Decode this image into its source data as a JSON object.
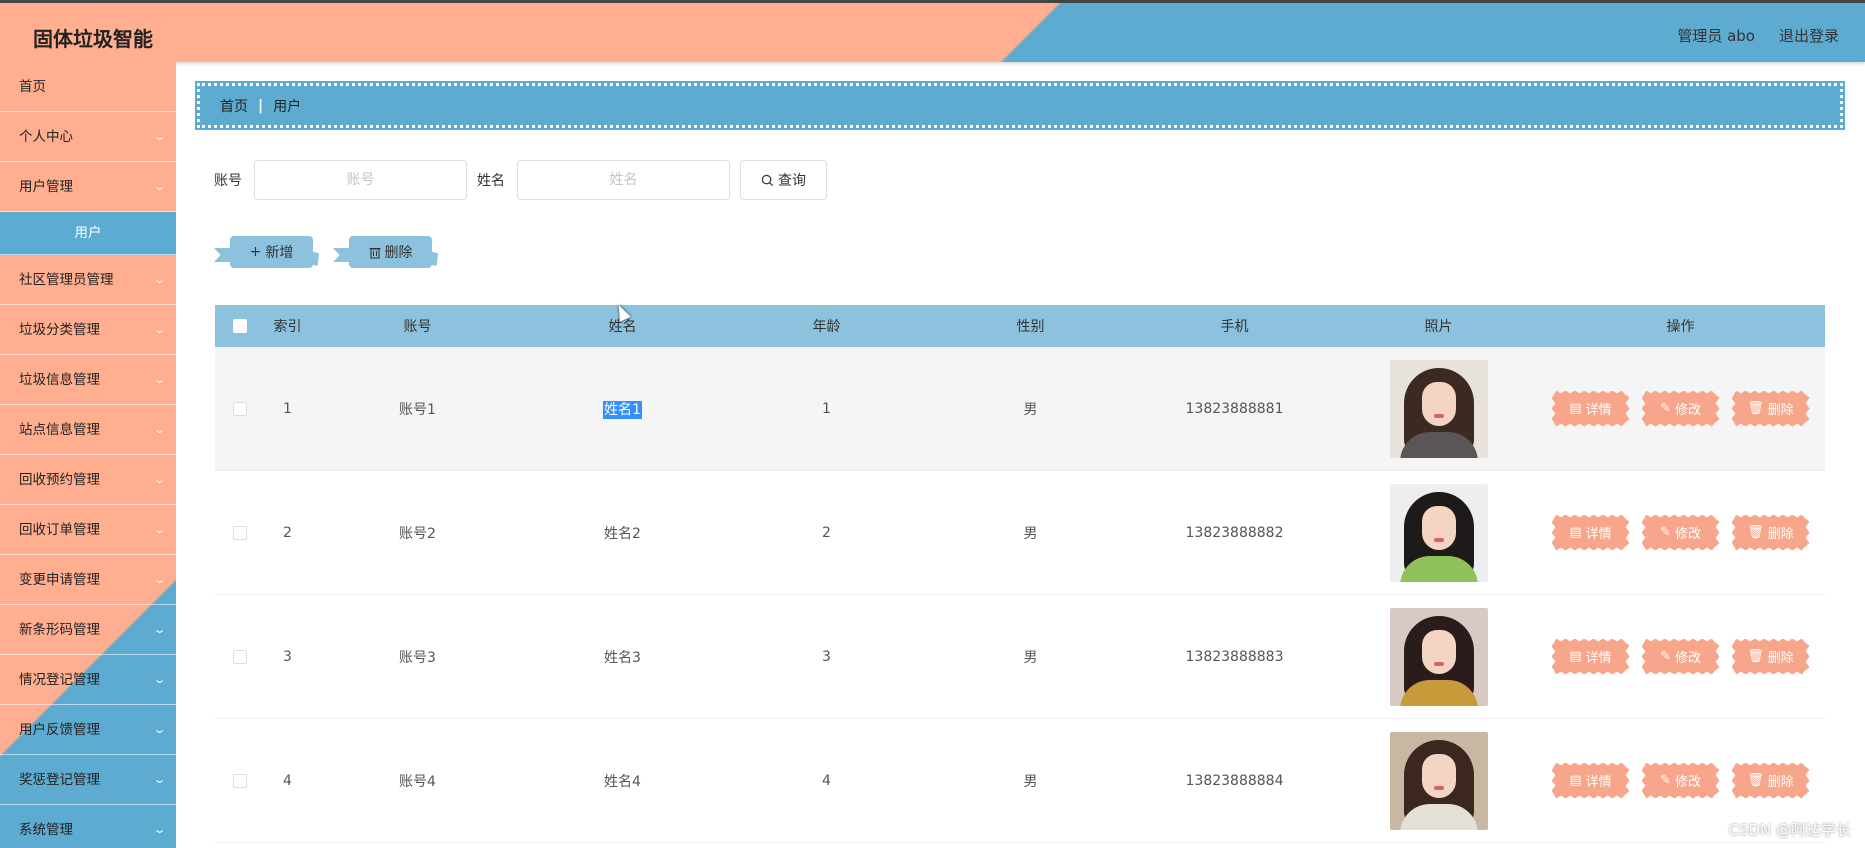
{
  "header": {
    "app_title": "固体垃圾智能",
    "admin_label": "管理员 abo",
    "logout_label": "退出登录"
  },
  "sidebar": {
    "items": [
      {
        "label": "首页",
        "has_chevron": false
      },
      {
        "label": "个人中心",
        "has_chevron": true
      },
      {
        "label": "用户管理",
        "has_chevron": true
      },
      {
        "label": "社区管理员管理",
        "has_chevron": true
      },
      {
        "label": "垃圾分类管理",
        "has_chevron": true
      },
      {
        "label": "垃圾信息管理",
        "has_chevron": true
      },
      {
        "label": "站点信息管理",
        "has_chevron": true
      },
      {
        "label": "回收预约管理",
        "has_chevron": true
      },
      {
        "label": "回收订单管理",
        "has_chevron": true
      },
      {
        "label": "变更申请管理",
        "has_chevron": true
      },
      {
        "label": "新条形码管理",
        "has_chevron": true
      },
      {
        "label": "情况登记管理",
        "has_chevron": true
      },
      {
        "label": "用户反馈管理",
        "has_chevron": true
      },
      {
        "label": "奖惩登记管理",
        "has_chevron": true
      },
      {
        "label": "系统管理",
        "has_chevron": true
      }
    ],
    "active_sub": "用户"
  },
  "breadcrumb": {
    "home": "首页",
    "separator": "|",
    "current": "用户"
  },
  "search": {
    "account_label": "账号",
    "account_placeholder": "账号",
    "account_value": "",
    "name_label": "姓名",
    "name_placeholder": "姓名",
    "name_value": "",
    "query_label": "查询"
  },
  "actions": {
    "add_label": "新增",
    "delete_label": "删除"
  },
  "table": {
    "headers": [
      "索引",
      "账号",
      "姓名",
      "年龄",
      "性别",
      "手机",
      "照片",
      "操作"
    ],
    "rows": [
      {
        "index": "1",
        "account": "账号1",
        "name": "姓名1",
        "age": "1",
        "gender": "男",
        "phone": "13823888881",
        "highlighted": true,
        "name_selected": true
      },
      {
        "index": "2",
        "account": "账号2",
        "name": "姓名2",
        "age": "2",
        "gender": "男",
        "phone": "13823888882",
        "highlighted": false,
        "name_selected": false
      },
      {
        "index": "3",
        "account": "账号3",
        "name": "姓名3",
        "age": "3",
        "gender": "男",
        "phone": "13823888883",
        "highlighted": false,
        "name_selected": false
      },
      {
        "index": "4",
        "account": "账号4",
        "name": "姓名4",
        "age": "4",
        "gender": "男",
        "phone": "13823888884",
        "highlighted": false,
        "name_selected": false
      }
    ],
    "row_actions": {
      "detail_label": "详情",
      "edit_label": "修改",
      "delete_label": "删除"
    }
  },
  "watermark": "CSDN @阿达学长",
  "colors": {
    "peach": "#ffae8f",
    "blue": "#5dabd0",
    "light_blue": "#8cc2de",
    "op_button": "#f7a68b"
  },
  "icons": {
    "query": "search-icon",
    "add": "plus-icon",
    "delete": "trash-icon",
    "detail": "document-icon",
    "edit": "pencil-icon",
    "chevron": "chevron-down-icon"
  }
}
